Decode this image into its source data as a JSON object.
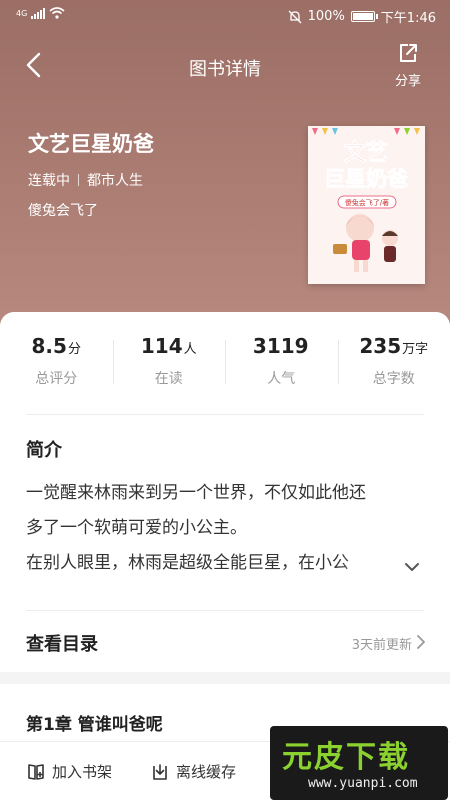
{
  "status_bar": {
    "network": "4G",
    "battery": "100%",
    "time": "下午1:46",
    "battery_level": 1.0
  },
  "nav": {
    "title": "图书详情",
    "share_label": "分享"
  },
  "book": {
    "title": "文艺巨星奶爸",
    "status": "连载中",
    "category": "都市人生",
    "author": "傻兔会飞了",
    "cover_title": "文艺巨星奶爸",
    "cover_author": "傻兔会飞了/著"
  },
  "stats": [
    {
      "value": "8.5",
      "unit": "分",
      "label": "总评分"
    },
    {
      "value": "114",
      "unit": "人",
      "label": "在读"
    },
    {
      "value": "3119",
      "unit": "",
      "label": "人气"
    },
    {
      "value": "235",
      "unit": "万字",
      "label": "总字数"
    }
  ],
  "intro": {
    "heading": "简介",
    "lines": [
      "一觉醒来林雨来到另一个世界，不仅如此他还",
      "多了一个软萌可爱的小公主。",
      "在别人眼里，林雨是超级全能巨星，在小公"
    ]
  },
  "toc": {
    "label": "查看目录",
    "update": "3天前更新"
  },
  "chapter": {
    "title": "第1章 管谁叫爸呢"
  },
  "bottom_bar": {
    "add_shelf": "加入书架",
    "offline_cache": "离线缓存"
  },
  "watermark": {
    "brand": "元皮下载",
    "url": "www.yuanpi.com"
  },
  "colors": {
    "hero": "#a87a70",
    "accent": "#8bd12f"
  }
}
